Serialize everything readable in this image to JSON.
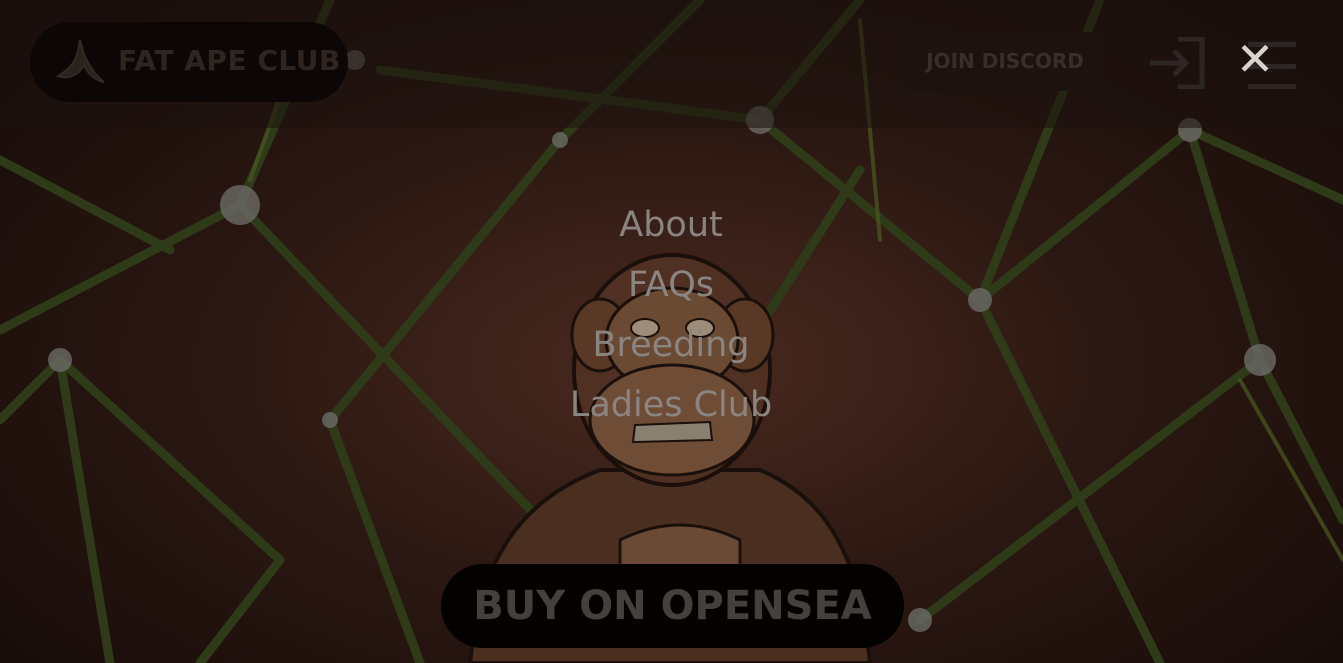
{
  "header": {
    "logo_text": "FAT APE CLUB",
    "discord_label": "JOIN DISCORD"
  },
  "icons": {
    "logo": "banana-icon",
    "login": "login-arrow-icon",
    "menu": "hamburger-menu-icon",
    "close": "close-icon"
  },
  "close_glyph": "✕",
  "nav": {
    "items": [
      {
        "label": "About"
      },
      {
        "label": "FAQs"
      },
      {
        "label": "Breeding"
      },
      {
        "label": "Ladies Club"
      }
    ]
  },
  "cta": {
    "label": "BUY ON OPENSEA"
  },
  "colors": {
    "overlay": "#1a0f0c",
    "nav_text": "#8b8582",
    "close": "#d9d3cf"
  }
}
